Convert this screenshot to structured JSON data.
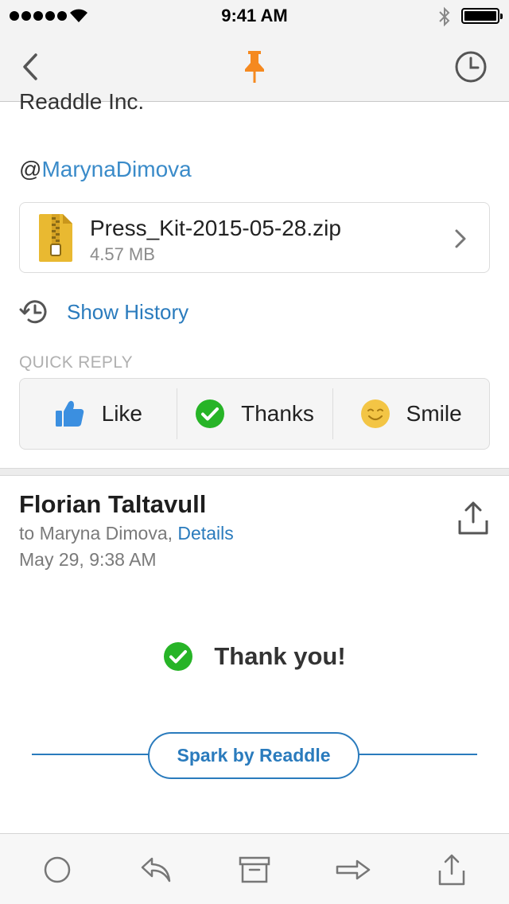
{
  "status_bar": {
    "time": "9:41 AM",
    "signal_icon": "signal-dots-icon",
    "wifi_icon": "wifi-icon",
    "bluetooth_icon": "bluetooth-icon",
    "battery_icon": "battery-icon",
    "battery_level": 1.0
  },
  "nav": {
    "back_icon": "chevron-left-icon",
    "pin_icon": "pin-icon",
    "pin_color": "#f5891f",
    "snooze_icon": "clock-icon"
  },
  "message1": {
    "cut_text": "Readdle Inc.",
    "mention_prefix": "@",
    "mention_name": "MarynaDimova",
    "attachment": {
      "name": "Press_Kit-2015-05-28.zip",
      "size": "4.57 MB",
      "icon": "zip-file-icon"
    },
    "show_history": "Show History",
    "quick_reply": {
      "label": "QUICK REPLY",
      "buttons": [
        {
          "label": "Like",
          "icon": "thumbs-up-icon",
          "color": "#3b8fe0"
        },
        {
          "label": "Thanks",
          "icon": "check-circle-icon",
          "color": "#27b427"
        },
        {
          "label": "Smile",
          "icon": "smile-icon",
          "color": "#f3c545"
        }
      ]
    }
  },
  "message2": {
    "sender": "Florian Taltavull",
    "to_prefix": "to Maryna Dimova,",
    "details_link": "Details",
    "date": "May 29, 9:38 AM",
    "body_text": "Thank you!",
    "signature_button": "Spark by Readdle",
    "accent_color": "#2a7bbd"
  },
  "toolbar": {
    "items": [
      {
        "icon": "circle-icon",
        "name": "mark-button"
      },
      {
        "icon": "reply-icon",
        "name": "reply-button"
      },
      {
        "icon": "archive-icon",
        "name": "archive-button"
      },
      {
        "icon": "forward-icon",
        "name": "forward-button"
      },
      {
        "icon": "share-icon",
        "name": "share-button"
      }
    ]
  }
}
